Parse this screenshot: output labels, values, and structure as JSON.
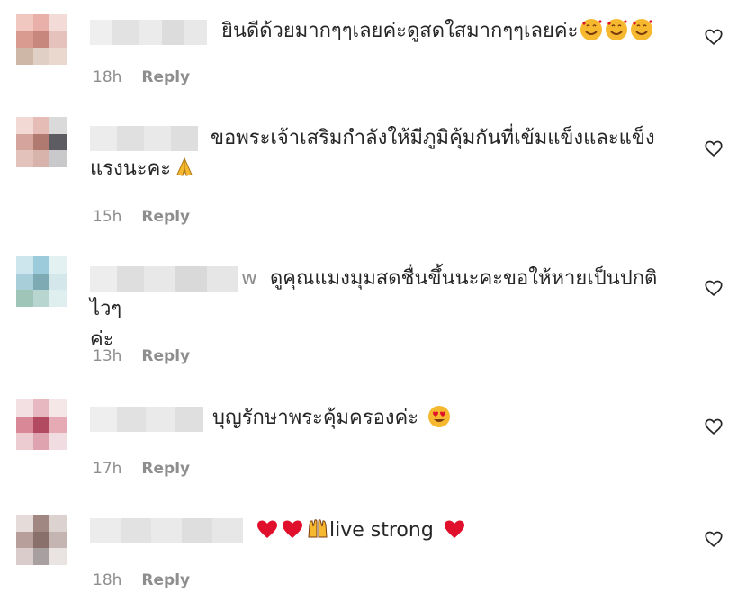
{
  "comments": [
    {
      "text": "ยินดีด้วยมากๆๆเลยค่ะดูสดใสมากๆๆเลยค่ะ",
      "emojis": [
        "smiling-face-with-hearts-emoji",
        "smiling-face-with-hearts-emoji",
        "smiling-face-with-hearts-emoji"
      ],
      "time": "18h",
      "reply": "Reply"
    },
    {
      "text_line1": "ขอพระเจ้าเสริมกำลังให้มีภูมิคุ้มกันที่เข้มแข็งและแข็ง",
      "text_line2": "แรงนะคะ",
      "emojis": [
        "folded-hands-emoji"
      ],
      "time": "15h",
      "reply": "Reply"
    },
    {
      "username_suffix": "w",
      "text_line1": "ดูคุณแมงมุมสดชื่นขึ้นนะคะขอให้หายเป็นปกติไวๆ",
      "text_line2": "ค่ะ",
      "time": "13h",
      "reply": "Reply"
    },
    {
      "text": "บุญรักษาพระคุ้มครองค่ะ",
      "emojis": [
        "heart-eyes-emoji"
      ],
      "time": "17h",
      "reply": "Reply"
    },
    {
      "text": "live strong",
      "emojis_before": [
        "red-heart-emoji",
        "red-heart-emoji",
        "raising-hands-emoji"
      ],
      "emojis_after": [
        "red-heart-emoji"
      ],
      "time": "18h",
      "reply": "Reply"
    }
  ],
  "icons": {
    "like": "heart-outline-icon"
  },
  "colors": {
    "text": "#262626",
    "meta": "#8e8e8e",
    "heart_emoji": "#e0102d",
    "emoji_face": "#f5b82e"
  }
}
